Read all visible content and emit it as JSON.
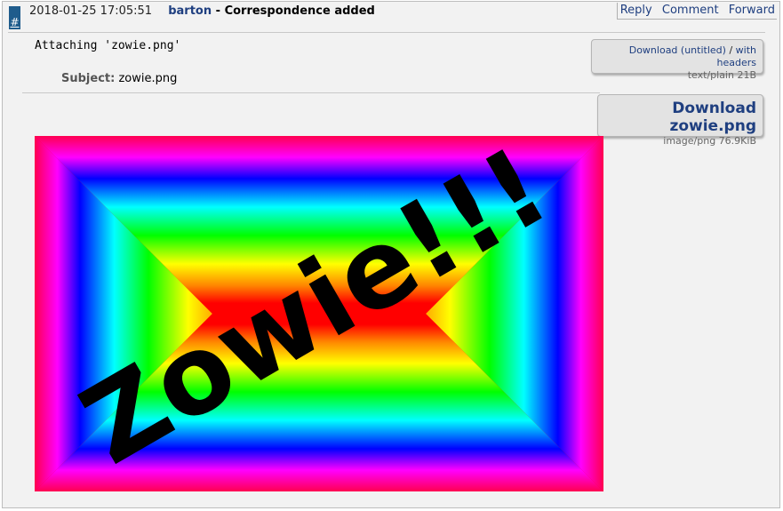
{
  "transaction": {
    "hash_label": "#",
    "date": "2018-01-25 17:05:51",
    "author": "barton",
    "separator": " - ",
    "description": "Correspondence added"
  },
  "actions": {
    "reply": "Reply",
    "comment": "Comment",
    "forward": "Forward"
  },
  "message": {
    "body": "Attaching 'zowie.png'",
    "subject_label": "Subject:",
    "subject_value": "zowie.png"
  },
  "attachment_text": {
    "download_label": "Download (untitled)",
    "slash": "/",
    "with_headers": "with headers",
    "mime": "text/plain 21B"
  },
  "attachment_image": {
    "download_label": "Download zowie.png",
    "mime": "image/png 76.9KiB",
    "image_text": "Zowie!!!"
  }
}
